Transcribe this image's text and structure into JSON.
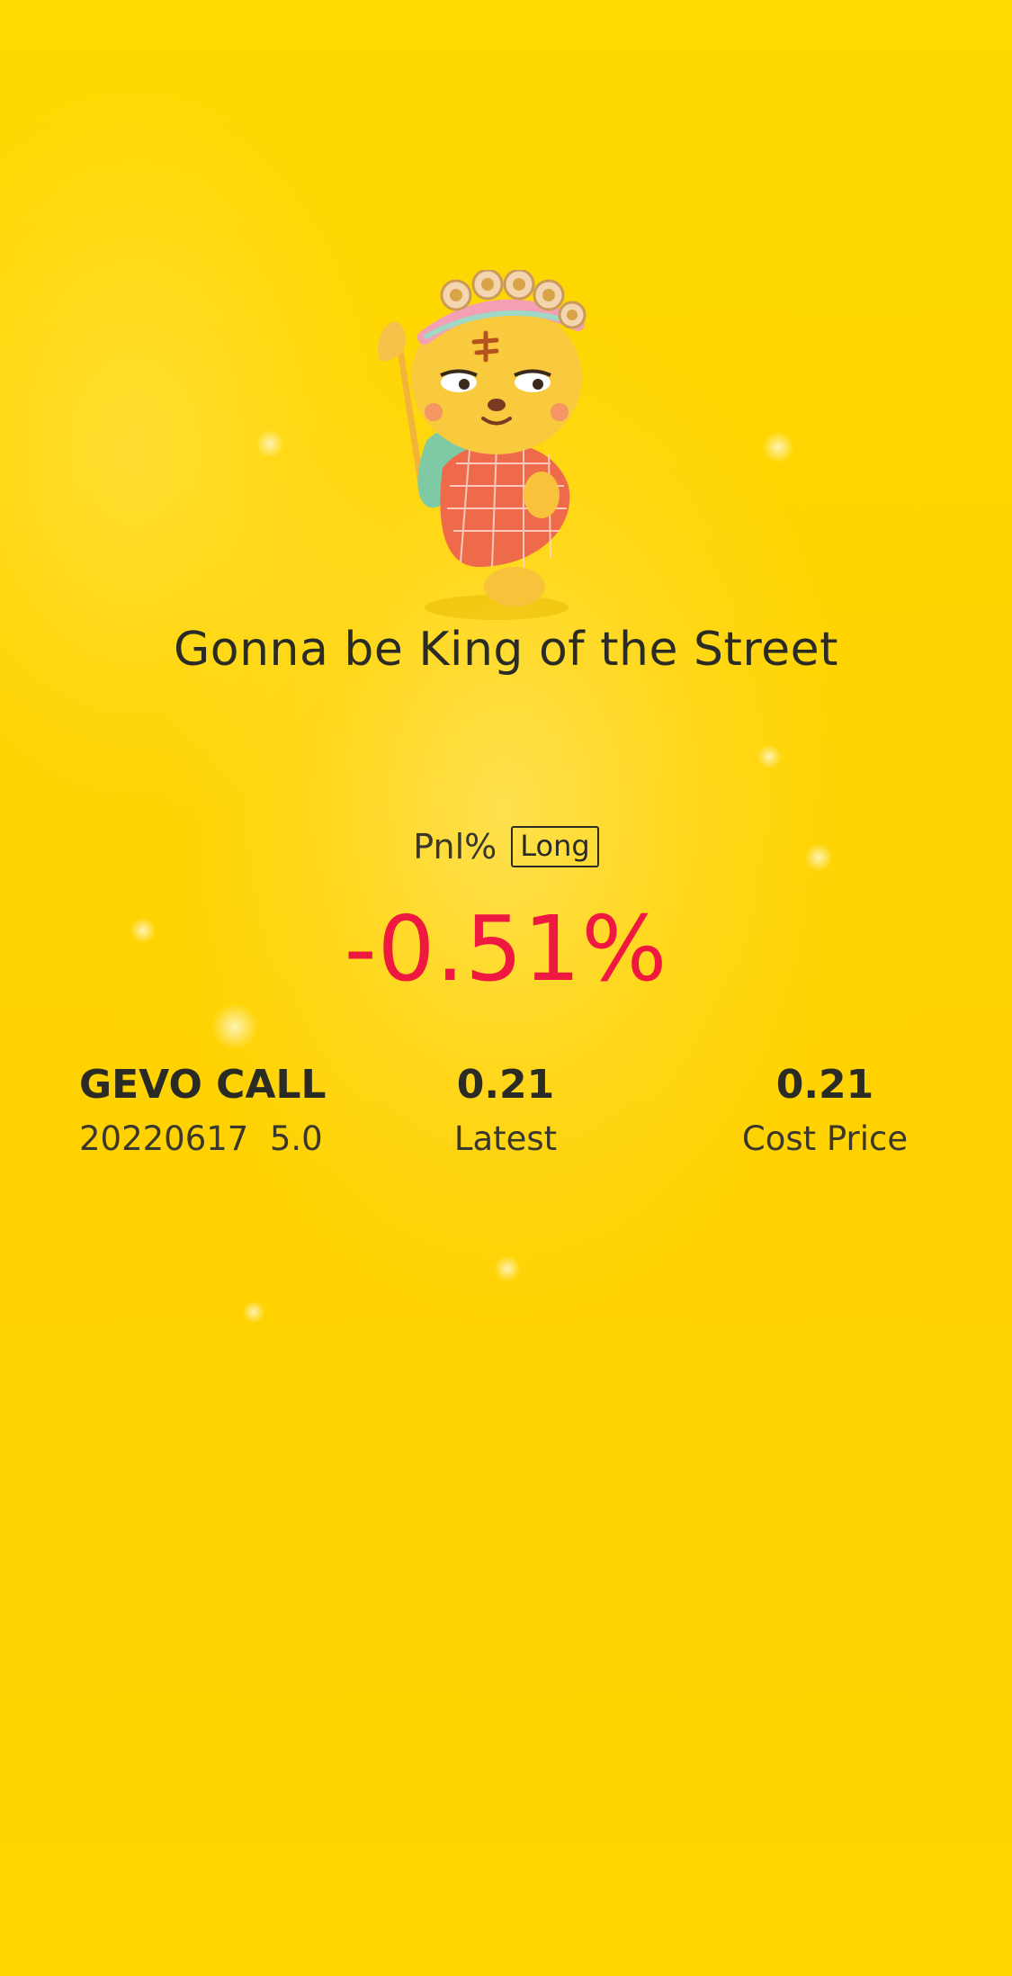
{
  "banner": {
    "title": "Gonna be King of the Street"
  },
  "pnl": {
    "label": "Pnl%",
    "direction_badge": "Long",
    "value": "-0.51%",
    "value_color": "#ee1840"
  },
  "position": {
    "name": "GEVO CALL",
    "details": "20220617  5.0",
    "latest_value": "0.21",
    "latest_label": "Latest",
    "cost_value": "0.21",
    "cost_label": "Cost Price"
  },
  "theme": {
    "background": "#ffd600",
    "text": "#2b2b26"
  },
  "mascot": {
    "icon": "tiger-king-mascot-icon"
  }
}
